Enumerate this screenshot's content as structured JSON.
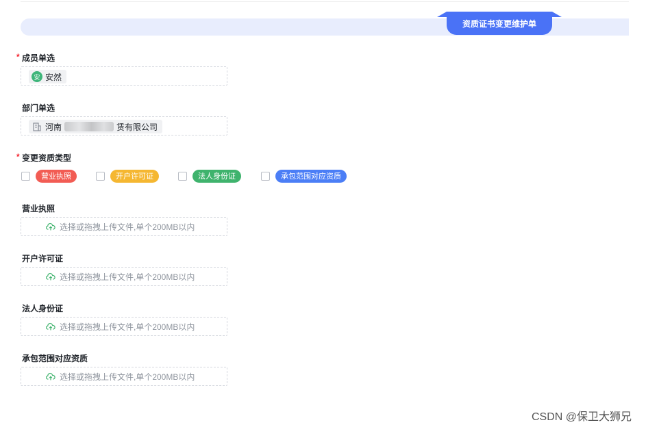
{
  "header": {
    "title": "资质证书变更维护单"
  },
  "fields": {
    "member": {
      "label": "成员单选",
      "required": "*",
      "chip_text": "安然",
      "avatar_char": "安",
      "avatar_color": "#3eb57a"
    },
    "department": {
      "label": "部门单选",
      "chip_prefix": "河南",
      "chip_suffix": "赁有限公司",
      "icon": "building-icon"
    },
    "change_type": {
      "label": "变更资质类型",
      "required": "*",
      "options": [
        {
          "label": "营业执照",
          "color": "#f25c54",
          "checked": false
        },
        {
          "label": "开户许可证",
          "color": "#f5b731",
          "checked": false
        },
        {
          "label": "法人身份证",
          "color": "#3fb36d",
          "checked": false
        },
        {
          "label": "承包范围对应资质",
          "color": "#4b7ef6",
          "checked": false
        }
      ]
    },
    "uploads": [
      {
        "label": "营业执照",
        "placeholder": "选择或拖拽上传文件,单个200MB以内"
      },
      {
        "label": "开户许可证",
        "placeholder": "选择或拖拽上传文件,单个200MB以内"
      },
      {
        "label": "法人身份证",
        "placeholder": "选择或拖拽上传文件,单个200MB以内"
      },
      {
        "label": "承包范围对应资质",
        "placeholder": "选择或拖拽上传文件,单个200MB以内"
      }
    ],
    "upload_icon": "cloud-upload-icon"
  },
  "watermark": "CSDN @保卫大狮兄"
}
